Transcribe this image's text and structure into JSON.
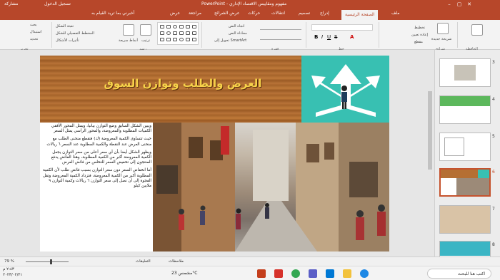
{
  "window": {
    "app_title": "PowerPoint - مفهوم ومقاييس الاقتصاد الإداري",
    "left_text": "تسجيل الدخول",
    "share": "مشاركة",
    "tell_me": "أخبرني بما تريد القيام به"
  },
  "tabs": [
    "ملف",
    "الصفحة الرئيسية",
    "إدراج",
    "تصميم",
    "انتقالات",
    "حركات",
    "عرض الشرائح",
    "مراجعة",
    "عرض"
  ],
  "active_tab": "الصفحة الرئيسية",
  "ribbon": {
    "groups": [
      "الحافظة",
      "شرائح",
      "خط",
      "فقرة",
      "رسم",
      "تحرير"
    ],
    "labels": {
      "new_slide": "شريحة جديدة",
      "layout": "تخطيط",
      "reset": "إعادة تعيين",
      "section": "مقطع",
      "text_direction": "اتجاه النص",
      "align_text": "محاذاة النص",
      "smartart": "تحويل إلى SmartArt",
      "arrange": "ترتيب",
      "quick_styles": "أنماط سريعة",
      "shape_fill": "تعبئة الشكل",
      "shape_outline": "المخطط التفصيلي للشكل",
      "shape_effects": "تأثيرات الأشكال",
      "find": "بحث",
      "replace": "استبدال",
      "select": "تحديد"
    }
  },
  "slide": {
    "title": "العرض والطلب وتوازن السوق",
    "bullets": [
      "ويبين الشكل السابق وضع التوازن بيانيا، ويمثل المحور الأفقي الكميات المطلوبة والمعروضة، والمحور الرأسي يمثل السعر",
      "حيث تتساوى الكمية المعروضة (ك) فتقطع منحنى الطلب مع منحنى العرض عند النقطة والكمية المطلوبة عند السعر ٦ ريالات",
      "ويظهر الشكل أيضا بأن أي سعر أعلى من سعر التوازن يجعل الكمية المعروضة أكبر من الكمية المطلوبة، وهذا الفائض يدفع المنتجون إلى تخفيض السعر للتخلص من فائض العرض",
      "أما انخفاض السعر دون سعر التوازن بسبب فائض طلب لأن الكمية المطلوبة أكبر من الكمية المعروضة، فتزداد الكمية المعروضة وتقل الفجوة إلى أن نصل إلى سعر التوازن ٦ ريالات وكمية التوازن ٩ ملايين كيلو"
    ]
  },
  "thumbnails": {
    "numbers": [
      "3",
      "4",
      "5",
      "6",
      "7",
      "8"
    ],
    "selected": "6"
  },
  "status": {
    "zoom": "79 %",
    "notes": "ملاحظات",
    "comments": "التعليقات"
  },
  "taskbar": {
    "search": "اكتب هنا للبحث",
    "weather": "مشمس 23°C",
    "time": "٢:٤٣ م",
    "date": "٢٠٢٣/٠٢/٢١"
  },
  "colors": {
    "accent": "#b7472a",
    "teal": "#38c0b2",
    "title_gold": "#f7d24a"
  }
}
